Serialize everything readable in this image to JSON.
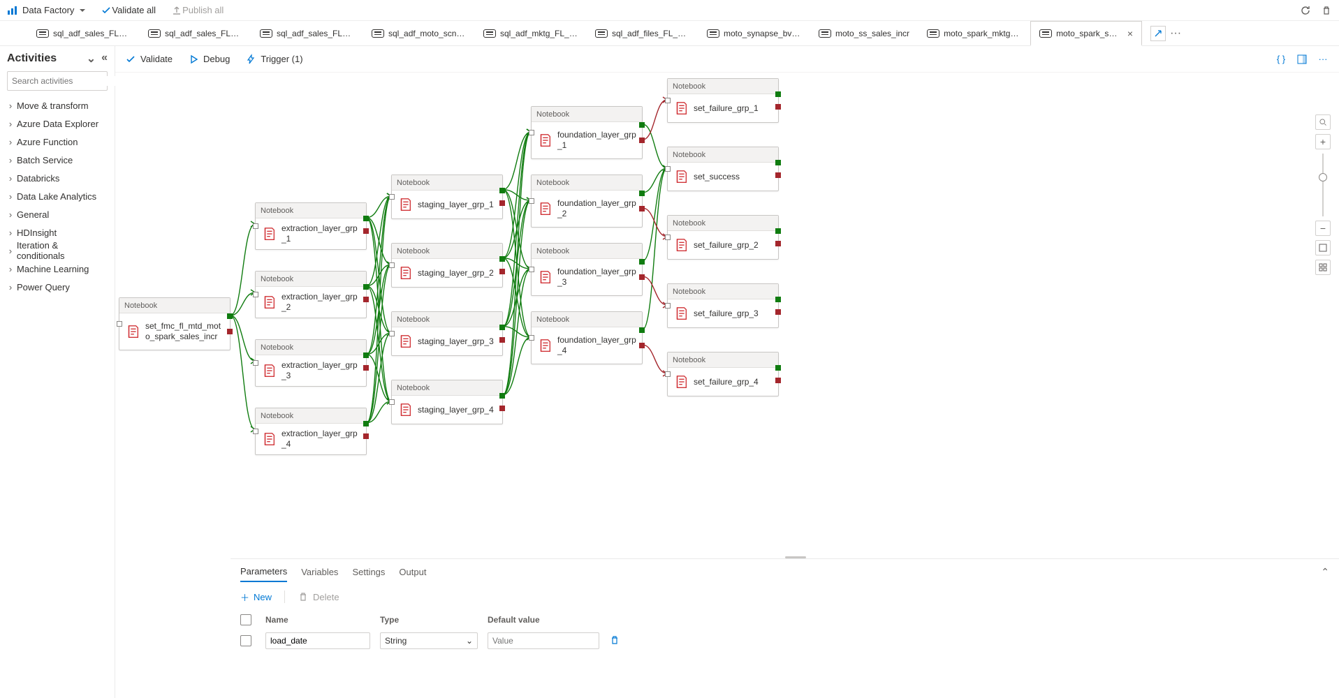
{
  "topbar": {
    "brand": "Data Factory",
    "validate_all": "Validate all",
    "publish_all": "Publish all"
  },
  "tabs": [
    {
      "label": "sql_adf_sales_FL_04..."
    },
    {
      "label": "sql_adf_sales_FL_04..."
    },
    {
      "label": "sql_adf_sales_FL_01..."
    },
    {
      "label": "sql_adf_moto_scn0..."
    },
    {
      "label": "sql_adf_mktg_FL_04..."
    },
    {
      "label": "sql_adf_files_FL_04..."
    },
    {
      "label": "moto_synapse_bv_i..."
    },
    {
      "label": "moto_ss_sales_incr"
    },
    {
      "label": "moto_spark_mktg_i..."
    },
    {
      "label": "moto_spark_sales_i...",
      "active": true
    }
  ],
  "sidebar": {
    "title": "Activities",
    "search_placeholder": "Search activities",
    "categories": [
      "Move & transform",
      "Azure Data Explorer",
      "Azure Function",
      "Batch Service",
      "Databricks",
      "Data Lake Analytics",
      "General",
      "HDInsight",
      "Iteration & conditionals",
      "Machine Learning",
      "Power Query"
    ]
  },
  "canvas_toolbar": {
    "validate": "Validate",
    "debug": "Debug",
    "trigger": "Trigger (1)"
  },
  "node_type_label": "Notebook",
  "nodes": {
    "n0": "set_fmc_fl_mtd_moto_spark_sales_incr",
    "e1": "extraction_layer_grp_1",
    "e2": "extraction_layer_grp_2",
    "e3": "extraction_layer_grp_3",
    "e4": "extraction_layer_grp_4",
    "s1": "staging_layer_grp_1",
    "s2": "staging_layer_grp_2",
    "s3": "staging_layer_grp_3",
    "s4": "staging_layer_grp_4",
    "f1": "foundation_layer_grp_1",
    "f2": "foundation_layer_grp_2",
    "f3": "foundation_layer_grp_3",
    "f4": "foundation_layer_grp_4",
    "sf1": "set_failure_grp_1",
    "ok": "set_success",
    "sf2": "set_failure_grp_2",
    "sf3": "set_failure_grp_3",
    "sf4": "set_failure_grp_4"
  },
  "bottom": {
    "tabs": [
      "Parameters",
      "Variables",
      "Settings",
      "Output"
    ],
    "active_tab": 0,
    "new": "New",
    "delete": "Delete",
    "headers": {
      "name": "Name",
      "type": "Type",
      "value": "Default value"
    },
    "rows": [
      {
        "name": "load_date",
        "type": "String",
        "value_placeholder": "Value"
      }
    ]
  }
}
